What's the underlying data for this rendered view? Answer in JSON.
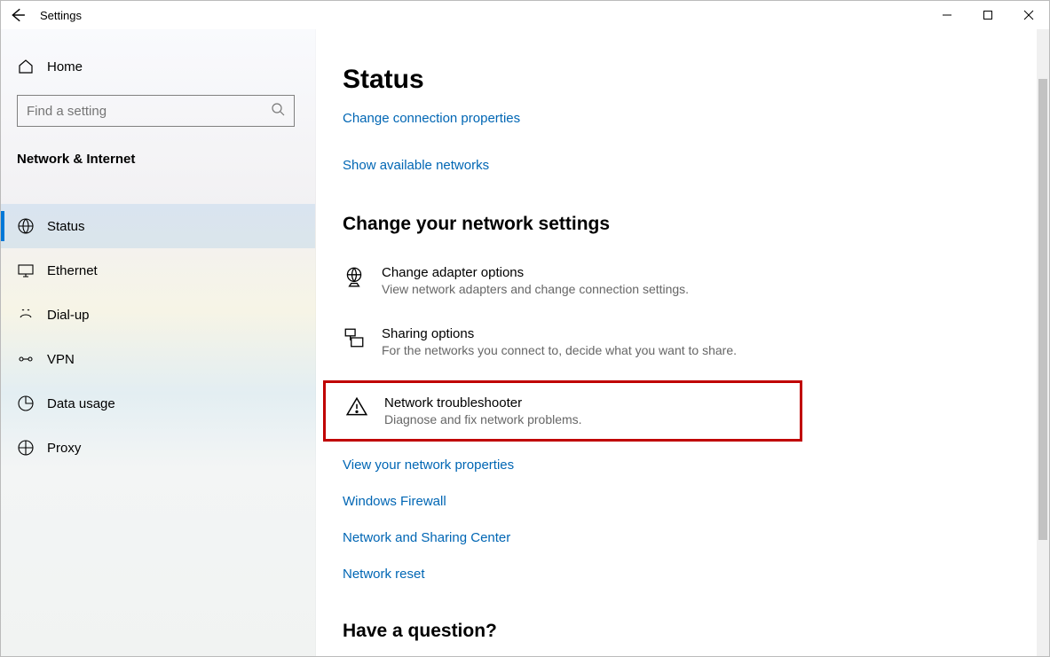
{
  "titlebar": {
    "title": "Settings"
  },
  "sidebar": {
    "home": "Home",
    "search_placeholder": "Find a setting",
    "subtitle": "Network & Internet",
    "items": [
      {
        "label": "Status",
        "icon": "globe"
      },
      {
        "label": "Ethernet",
        "icon": "monitor"
      },
      {
        "label": "Dial-up",
        "icon": "dialup"
      },
      {
        "label": "VPN",
        "icon": "vpn"
      },
      {
        "label": "Data usage",
        "icon": "datausage"
      },
      {
        "label": "Proxy",
        "icon": "proxy"
      }
    ]
  },
  "main": {
    "title": "Status",
    "links_top": [
      "Change connection properties",
      "Show available networks"
    ],
    "section_heading": "Change your network settings",
    "settings": [
      {
        "title": "Change adapter options",
        "sub": "View network adapters and change connection settings."
      },
      {
        "title": "Sharing options",
        "sub": "For the networks you connect to, decide what you want to share."
      },
      {
        "title": "Network troubleshooter",
        "sub": "Diagnose and fix network problems."
      }
    ],
    "links_bottom": [
      "View your network properties",
      "Windows Firewall",
      "Network and Sharing Center",
      "Network reset"
    ],
    "question_heading": "Have a question?"
  }
}
